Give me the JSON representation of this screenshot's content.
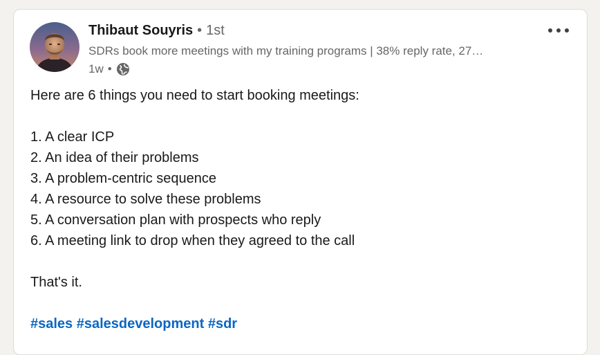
{
  "post": {
    "author": {
      "name": "Thibaut Souyris",
      "separator": "•",
      "connection_degree": "1st",
      "headline": "SDRs book more meetings with my training programs | 38% reply rate, 27…",
      "posted_ago": "1w",
      "visibility_icon": "globe-icon"
    },
    "more_icon": "more-horizontal-icon",
    "intro": "Here are 6 things you need to start booking meetings:",
    "items": [
      "1. A clear ICP",
      "2. An idea of their problems",
      "3. A problem-centric sequence",
      "4. A resource to solve these problems",
      "5. A conversation plan with prospects who reply",
      "6. A meeting link to drop when they agreed to the call"
    ],
    "closing": "That's it.",
    "hashtags": [
      "#sales",
      "#salesdevelopment",
      "#sdr"
    ]
  },
  "colors": {
    "hashtag": "#0a66c2",
    "text_primary": "#191919",
    "text_secondary": "#666666",
    "page_background": "#f4f2ee"
  }
}
